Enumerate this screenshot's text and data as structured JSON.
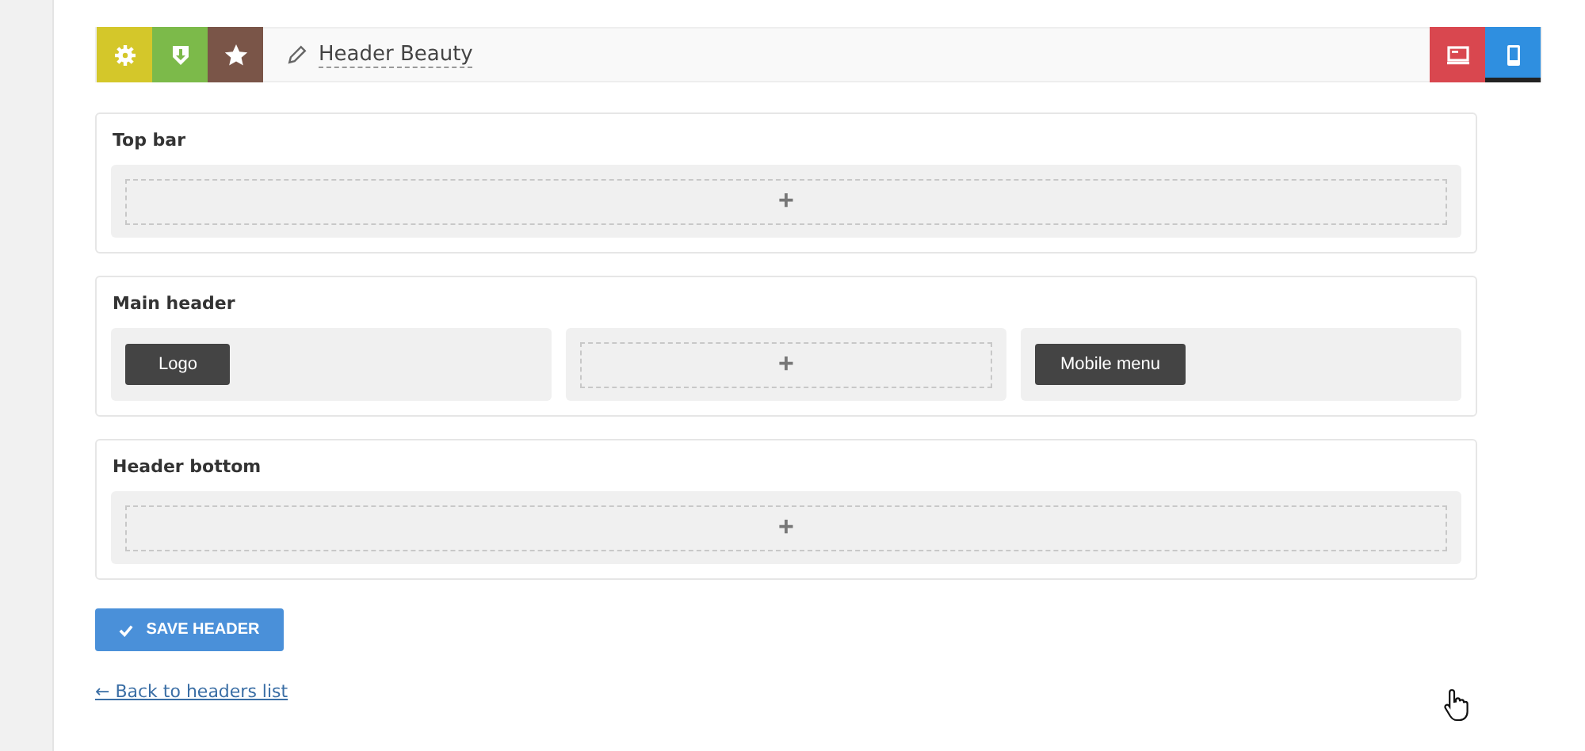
{
  "toolbar": {
    "actions": [
      {
        "kind": "settings",
        "color": "#d4c72a"
      },
      {
        "kind": "download",
        "color": "#7cba4a"
      },
      {
        "kind": "star",
        "color": "#7a5548"
      }
    ],
    "title": "Header Beauty",
    "views": [
      {
        "kind": "desktop",
        "color": "#d9474f",
        "selected": false
      },
      {
        "kind": "mobile",
        "color": "#2f8fe0",
        "selected": true
      }
    ]
  },
  "sections": [
    {
      "title": "Top bar",
      "cells": [
        {
          "kind": "empty",
          "add": "+"
        }
      ]
    },
    {
      "title": "Main header",
      "cells": [
        {
          "kind": "element",
          "label": "Logo"
        },
        {
          "kind": "empty",
          "add": "+"
        },
        {
          "kind": "element",
          "label": "Mobile menu"
        }
      ]
    },
    {
      "title": "Header bottom",
      "cells": [
        {
          "kind": "empty",
          "add": "+"
        }
      ]
    }
  ],
  "save_button": "SAVE HEADER",
  "back_link": "← Back to headers list"
}
